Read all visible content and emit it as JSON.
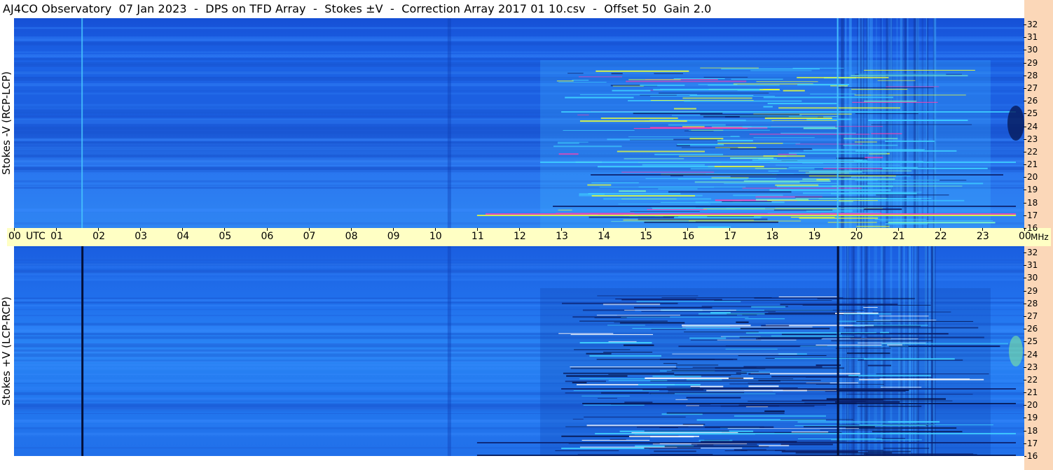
{
  "title": "AJ4CO Observatory  07 Jan 2023  -  DPS on TFD Array  -  Stokes ±V  -  Correction Array 2017 01 10.csv  -  Offset 50  Gain 2.0",
  "colors": {
    "axis_band": "#ffffc4",
    "freq_strip": "#fbd7b8",
    "background_blue": "#1f6fe8",
    "dark_blue": "#0a2f8a",
    "cyan": "#3fd0ff",
    "yellow": "#e8ff3a",
    "magenta": "#ff3fb0"
  },
  "chart_data": [
    {
      "type": "heatmap",
      "panel": "top",
      "label": "Stokes -V (RCP-LCP)",
      "x_unit": "UTC",
      "y_unit": "MHz",
      "x_ticks": [
        "00",
        "01",
        "02",
        "03",
        "04",
        "05",
        "06",
        "07",
        "08",
        "09",
        "10",
        "11",
        "12",
        "13",
        "14",
        "15",
        "16",
        "17",
        "18",
        "19",
        "20",
        "21",
        "22",
        "23",
        "00"
      ],
      "y_ticks": [
        "32",
        "31",
        "30",
        "29",
        "28",
        "27",
        "26",
        "25",
        "24",
        "23",
        "22",
        "21",
        "20",
        "19",
        "18",
        "17",
        "16"
      ],
      "xlim": [
        0,
        24
      ],
      "ylim": [
        16,
        32.5
      ]
    },
    {
      "type": "heatmap",
      "panel": "bottom",
      "label": "Stokes +V (LCP-RCP)",
      "x_unit": "UTC",
      "y_unit": "MHz",
      "x_ticks": [
        "00",
        "01",
        "02",
        "03",
        "04",
        "05",
        "06",
        "07",
        "08",
        "09",
        "10",
        "11",
        "12",
        "13",
        "14",
        "15",
        "16",
        "17",
        "18",
        "19",
        "20",
        "21",
        "22",
        "23",
        "00"
      ],
      "y_ticks": [
        "32",
        "31",
        "30",
        "29",
        "28",
        "27",
        "26",
        "25",
        "24",
        "23",
        "22",
        "21",
        "20",
        "19",
        "18",
        "17",
        "16"
      ],
      "xlim": [
        0,
        24
      ],
      "ylim": [
        16,
        32.5
      ]
    }
  ],
  "axis": {
    "utc_label": "UTC",
    "mhz_label": "MHz",
    "hours": [
      "00",
      "01",
      "02",
      "03",
      "04",
      "05",
      "06",
      "07",
      "08",
      "09",
      "10",
      "11",
      "12",
      "13",
      "14",
      "15",
      "16",
      "17",
      "18",
      "19",
      "20",
      "21",
      "22",
      "23",
      "00"
    ],
    "freqs": [
      "32",
      "31",
      "30",
      "29",
      "28",
      "27",
      "26",
      "25",
      "24",
      "23",
      "22",
      "21",
      "20",
      "19",
      "18",
      "17",
      "16"
    ]
  }
}
